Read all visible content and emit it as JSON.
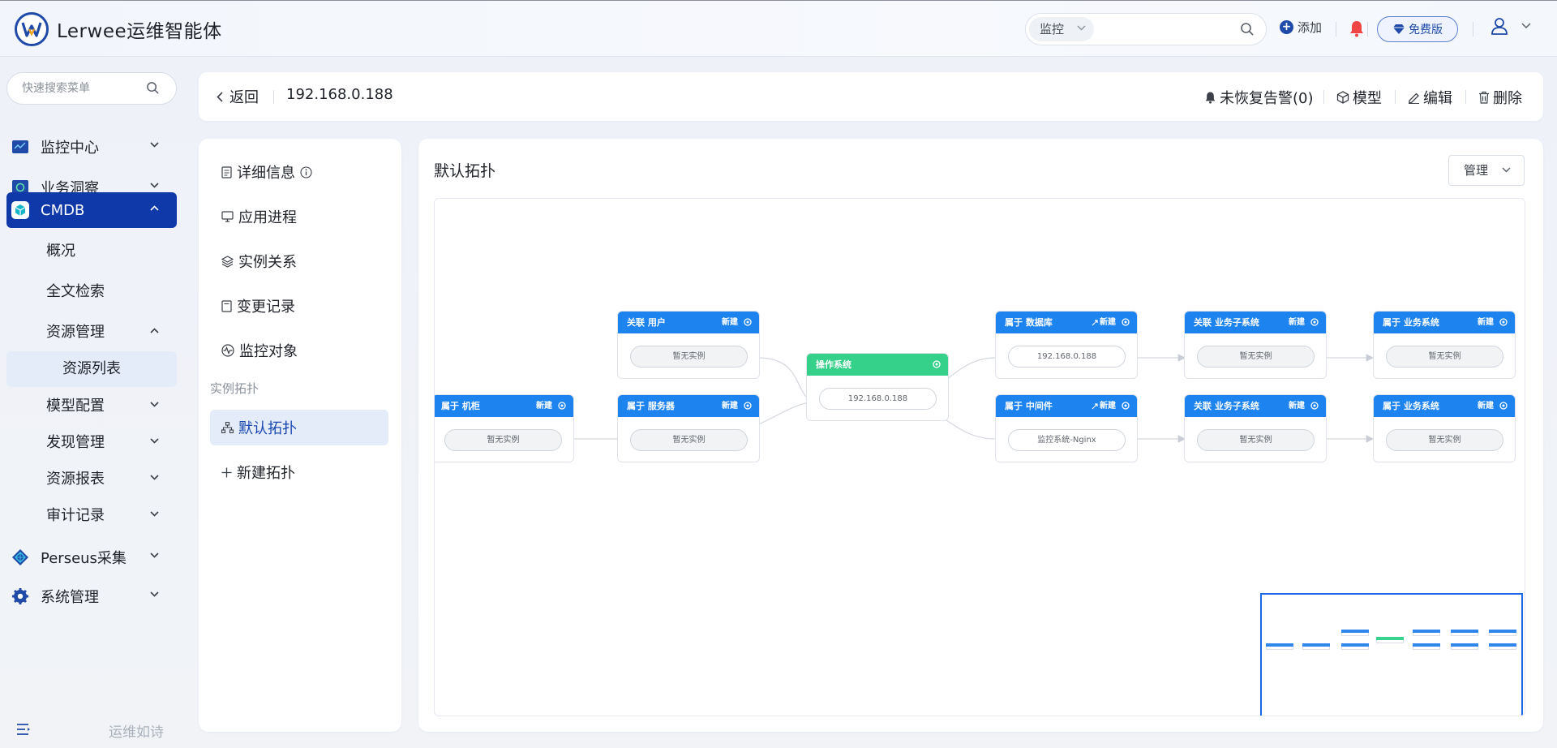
{
  "header": {
    "app_title": "Lerwee运维智能体",
    "search_select": "监控",
    "add_label": "添加",
    "free_label": "免费版"
  },
  "sidebar": {
    "search_placeholder": "快速搜索菜单",
    "items": [
      {
        "label": "监控中心"
      },
      {
        "label": "业务洞察"
      },
      {
        "label": "CMDB"
      },
      {
        "label": "概况"
      },
      {
        "label": "全文检索"
      },
      {
        "label": "资源管理"
      },
      {
        "label": "资源列表"
      },
      {
        "label": "模型配置"
      },
      {
        "label": "发现管理"
      },
      {
        "label": "资源报表"
      },
      {
        "label": "审计记录"
      },
      {
        "label": "Perseus采集"
      },
      {
        "label": "系统管理"
      }
    ],
    "footer_text": "运维如诗"
  },
  "topbar": {
    "back_label": "返回",
    "title": "192.168.0.188",
    "alarm_label": "未恢复告警(0)",
    "model_label": "模型",
    "edit_label": "编辑",
    "delete_label": "删除"
  },
  "leftnav": {
    "items": [
      {
        "label": "详细信息"
      },
      {
        "label": "应用进程"
      },
      {
        "label": "实例关系"
      },
      {
        "label": "变更记录"
      },
      {
        "label": "监控对象"
      }
    ],
    "group_label": "实例拓扑",
    "topo_items": [
      {
        "label": "默认拓扑"
      },
      {
        "label": "新建拓扑"
      }
    ]
  },
  "main": {
    "title": "默认拓扑",
    "manage_label": "管理"
  },
  "topology": {
    "new_label": "新建",
    "nodes": [
      {
        "id": "jigui",
        "title": "属于 机柜",
        "value": "暂无实例"
      },
      {
        "id": "user",
        "title": "关联 用户",
        "value": "暂无实例"
      },
      {
        "id": "server",
        "title": "属于 服务器",
        "value": "暂无实例"
      },
      {
        "id": "os",
        "title": "操作系统",
        "value": "192.168.0.188"
      },
      {
        "id": "db",
        "title": "属于 数据库",
        "value": "192.168.0.188"
      },
      {
        "id": "mw",
        "title": "属于 中间件",
        "value": "监控系统-Nginx"
      },
      {
        "id": "sub1",
        "title": "关联 业务子系统",
        "value": "暂无实例"
      },
      {
        "id": "sub2",
        "title": "关联 业务子系统",
        "value": "暂无实例"
      },
      {
        "id": "biz1",
        "title": "属于 业务系统",
        "value": "暂无实例"
      },
      {
        "id": "biz2",
        "title": "属于 业务系统",
        "value": "暂无实例"
      }
    ]
  },
  "colors": {
    "brand": "#0f39a8",
    "node_blue": "#1d83ee",
    "node_green": "#35d08a",
    "bell_red": "#f04545"
  }
}
